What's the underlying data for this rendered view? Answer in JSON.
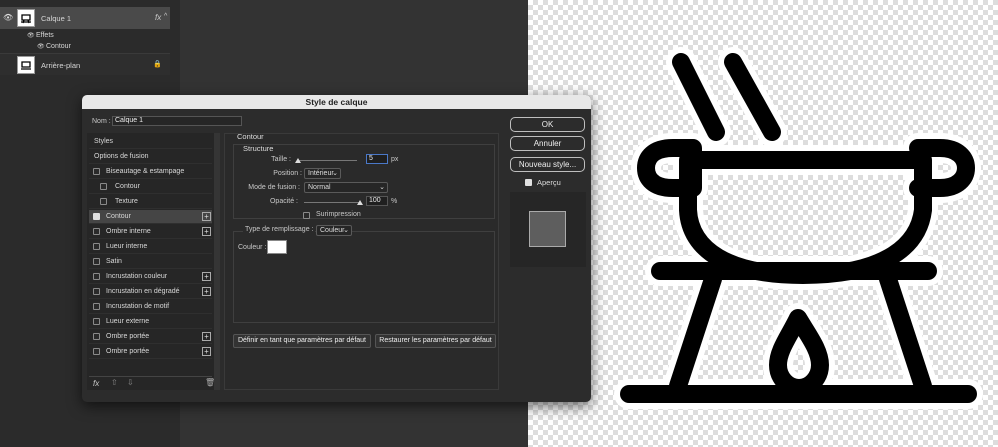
{
  "layers": {
    "layer1": "Calque 1",
    "effects": "Effets",
    "contour": "Contour",
    "background": "Arrière-plan",
    "fx": "fx"
  },
  "dialog": {
    "title": "Style de calque",
    "name_label": "Nom :",
    "name_value": "Calque 1",
    "sidebar": [
      {
        "label": "Styles",
        "checkbox": false,
        "checked": false,
        "plus": false,
        "sub": false,
        "active": false
      },
      {
        "label": "Options de fusion",
        "checkbox": false,
        "checked": false,
        "plus": false,
        "sub": false,
        "active": false
      },
      {
        "label": "Biseautage & estampage",
        "checkbox": true,
        "checked": false,
        "plus": false,
        "sub": false,
        "active": false
      },
      {
        "label": "Contour",
        "checkbox": true,
        "checked": false,
        "plus": false,
        "sub": true,
        "active": false
      },
      {
        "label": "Texture",
        "checkbox": true,
        "checked": false,
        "plus": false,
        "sub": true,
        "active": false
      },
      {
        "label": "Contour",
        "checkbox": true,
        "checked": true,
        "plus": true,
        "sub": false,
        "active": true
      },
      {
        "label": "Ombre interne",
        "checkbox": true,
        "checked": false,
        "plus": true,
        "sub": false,
        "active": false
      },
      {
        "label": "Lueur interne",
        "checkbox": true,
        "checked": false,
        "plus": false,
        "sub": false,
        "active": false
      },
      {
        "label": "Satin",
        "checkbox": true,
        "checked": false,
        "plus": false,
        "sub": false,
        "active": false
      },
      {
        "label": "Incrustation couleur",
        "checkbox": true,
        "checked": false,
        "plus": true,
        "sub": false,
        "active": false
      },
      {
        "label": "Incrustation en dégradé",
        "checkbox": true,
        "checked": false,
        "plus": true,
        "sub": false,
        "active": false
      },
      {
        "label": "Incrustation de motif",
        "checkbox": true,
        "checked": false,
        "plus": false,
        "sub": false,
        "active": false
      },
      {
        "label": "Lueur externe",
        "checkbox": true,
        "checked": false,
        "plus": false,
        "sub": false,
        "active": false
      },
      {
        "label": "Ombre portée",
        "checkbox": true,
        "checked": false,
        "plus": true,
        "sub": false,
        "active": false
      },
      {
        "label": "Ombre portée",
        "checkbox": true,
        "checked": false,
        "plus": true,
        "sub": false,
        "active": false
      }
    ],
    "footer_fx": "fx",
    "section_title": "Contour",
    "structure_title": "Structure",
    "size_label": "Taille :",
    "size_value": "5",
    "size_unit": "px",
    "size_level": 0.02,
    "position_label": "Position :",
    "position_value": "Intérieur",
    "blend_label": "Mode de fusion :",
    "blend_value": "Normal",
    "opacity_label": "Opacité :",
    "opacity_value": "100",
    "opacity_unit": "%",
    "opacity_level": 1.0,
    "overprint_label": "Surimpression",
    "fill_type_label": "Type de remplissage :",
    "fill_type_value": "Couleur",
    "color_label": "Couleur :",
    "color_value": "#ffffff",
    "set_default": "Définir en tant que paramètres par défaut",
    "reset_default": "Restaurer les paramètres par défaut",
    "ok": "OK",
    "cancel": "Annuler",
    "new_style": "Nouveau style...",
    "preview": "Aperçu"
  },
  "colors": {
    "dialog_bg": "#2c2c2c",
    "title_bar": "#e8e8e8",
    "canvas": "#ffffff",
    "icon": "#000000"
  }
}
